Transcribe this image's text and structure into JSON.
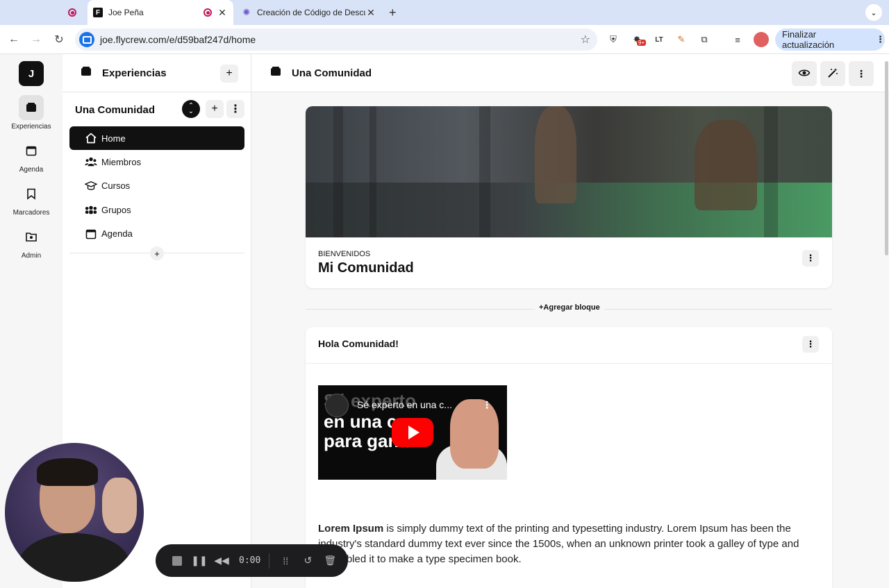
{
  "browser": {
    "tabs": [
      {
        "title": "",
        "favicon": "record-icon"
      },
      {
        "title": "Joe Peña",
        "favicon": "flycrew-icon",
        "active": true
      },
      {
        "title": "Creación de Código de Descu",
        "favicon": "gear-favicon-icon"
      }
    ],
    "url": "joe.flycrew.com/e/d59baf247d/home",
    "extension_badge": "9+",
    "update_label": "Finalizar actualización"
  },
  "rail": {
    "avatar_letter": "J",
    "items": [
      {
        "label": "Experiencias",
        "icon": "box-icon",
        "active": true
      },
      {
        "label": "Agenda",
        "icon": "calendar-icon"
      },
      {
        "label": "Marcadores",
        "icon": "bookmark-icon"
      },
      {
        "label": "Admin",
        "icon": "admin-folder-icon"
      }
    ]
  },
  "sidebar": {
    "title": "Experiencias",
    "community_name": "Una Comunidad",
    "nav": [
      {
        "label": "Home",
        "icon": "home-icon",
        "active": true
      },
      {
        "label": "Miembros",
        "icon": "members-icon"
      },
      {
        "label": "Cursos",
        "icon": "graduation-cap-icon"
      },
      {
        "label": "Grupos",
        "icon": "groups-icon"
      },
      {
        "label": "Agenda",
        "icon": "calendar-icon"
      }
    ]
  },
  "main": {
    "title": "Una Comunidad",
    "hero": {
      "kicker": "BIENVENIDOS",
      "title": "Mi Comunidad"
    },
    "add_block_label": "+Agregar bloque",
    "post": {
      "title": "Hola Comunidad!",
      "video": {
        "title": "Sé experto en una c...",
        "overlay_lines": [
          "Sé experto",
          "en una cosa",
          "para ganar"
        ]
      },
      "body_bold": "Lorem Ipsum",
      "body_text": " is simply dummy text of the printing and typesetting industry. Lorem Ipsum has been the industry's standard dummy text ever since the 1500s, when an unknown printer took a galley of type and scrambled it to make a type specimen book."
    }
  },
  "recorder": {
    "time": "0:00"
  },
  "colors": {
    "accent_black": "#111111",
    "tabstrip": "#d9e3f7",
    "update_button": "#d3e3fd",
    "youtube_red": "#ff0000"
  }
}
